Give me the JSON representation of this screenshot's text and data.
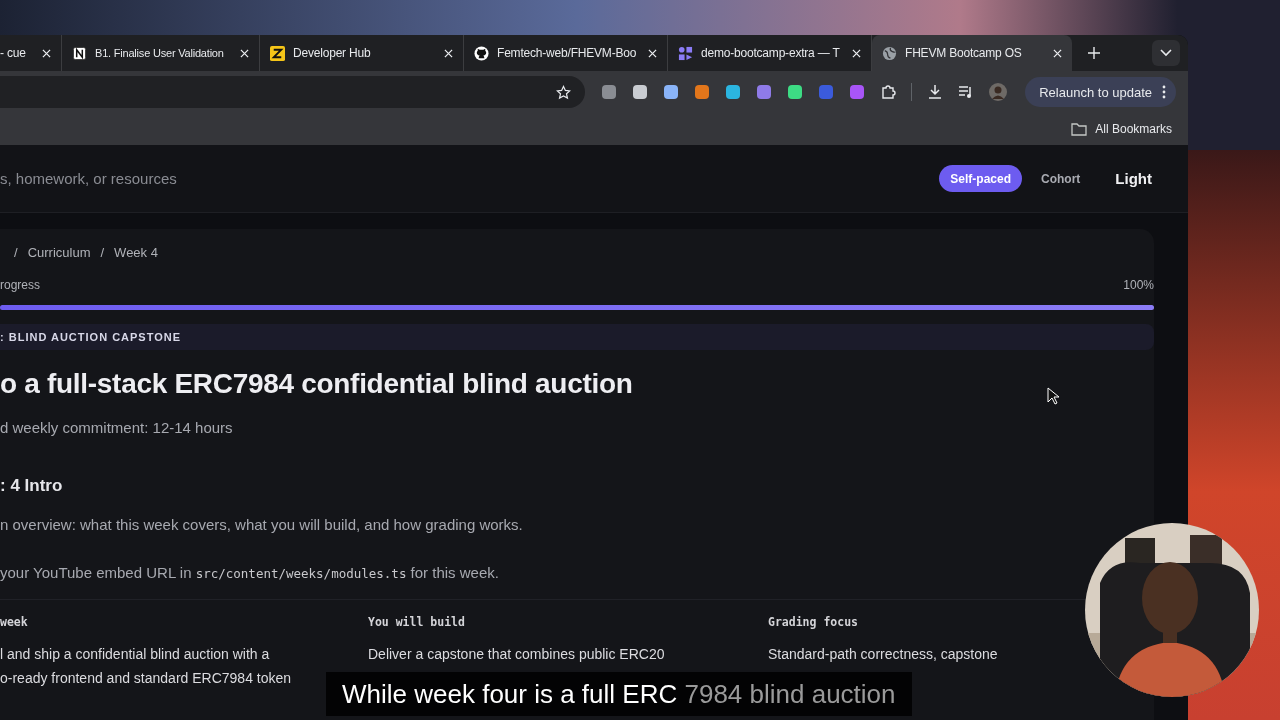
{
  "tabs": [
    {
      "label": "- cue",
      "selected": false
    },
    {
      "label": "B1. Finalise User Validation",
      "selected": false
    },
    {
      "label": "Developer Hub",
      "selected": false
    },
    {
      "label": "Femtech-web/FHEVM-Boo",
      "selected": false
    },
    {
      "label": "demo-bootcamp-extra — T",
      "selected": false
    },
    {
      "label": "FHEVM Bootcamp OS",
      "selected": true
    }
  ],
  "toolbar": {
    "relaunch_button": "Relaunch to update",
    "bookmarks": "All Bookmarks"
  },
  "header": {
    "search": {
      "placeholder": "s, homework, or resources"
    },
    "modes": [
      {
        "label": "Self-paced",
        "selected": true
      },
      {
        "label": "Cohort",
        "selected": false
      }
    ],
    "theme_button": "Light"
  },
  "breadcrumb": [
    {
      "separator": "/",
      "label": "Curriculum"
    },
    {
      "separator": "/",
      "label": "Week 4"
    }
  ],
  "progress": {
    "label": "rogress",
    "reading": "100%",
    "level": 1
  },
  "badge": ": BLIND AUCTION CAPSTONE",
  "title": "o a full-stack ERC7984 confidential blind auction",
  "commitment": "d weekly commitment: 12-14 hours",
  "section_title": ": 4 Intro",
  "overview": "n overview: what this week covers, what you will build, and how grading works.",
  "video_note": {
    "before": "your YouTube embed URL in ",
    "code": "src/content/weeks/modules.ts",
    "after": " for this week."
  },
  "columns": [
    {
      "heading": "week",
      "lines": [
        "l and ship a confidential blind auction with a",
        "o-ready frontend and standard ERC7984 token"
      ]
    },
    {
      "heading": "You will build",
      "lines": [
        "Deliver a capstone that combines public ERC20"
      ]
    },
    {
      "heading": "Grading focus",
      "lines": [
        "Standard-path correctness, capstone"
      ]
    }
  ],
  "caption": {
    "spoken": "While week four is a full ERC",
    "upcoming": " 7984 blind auction"
  }
}
